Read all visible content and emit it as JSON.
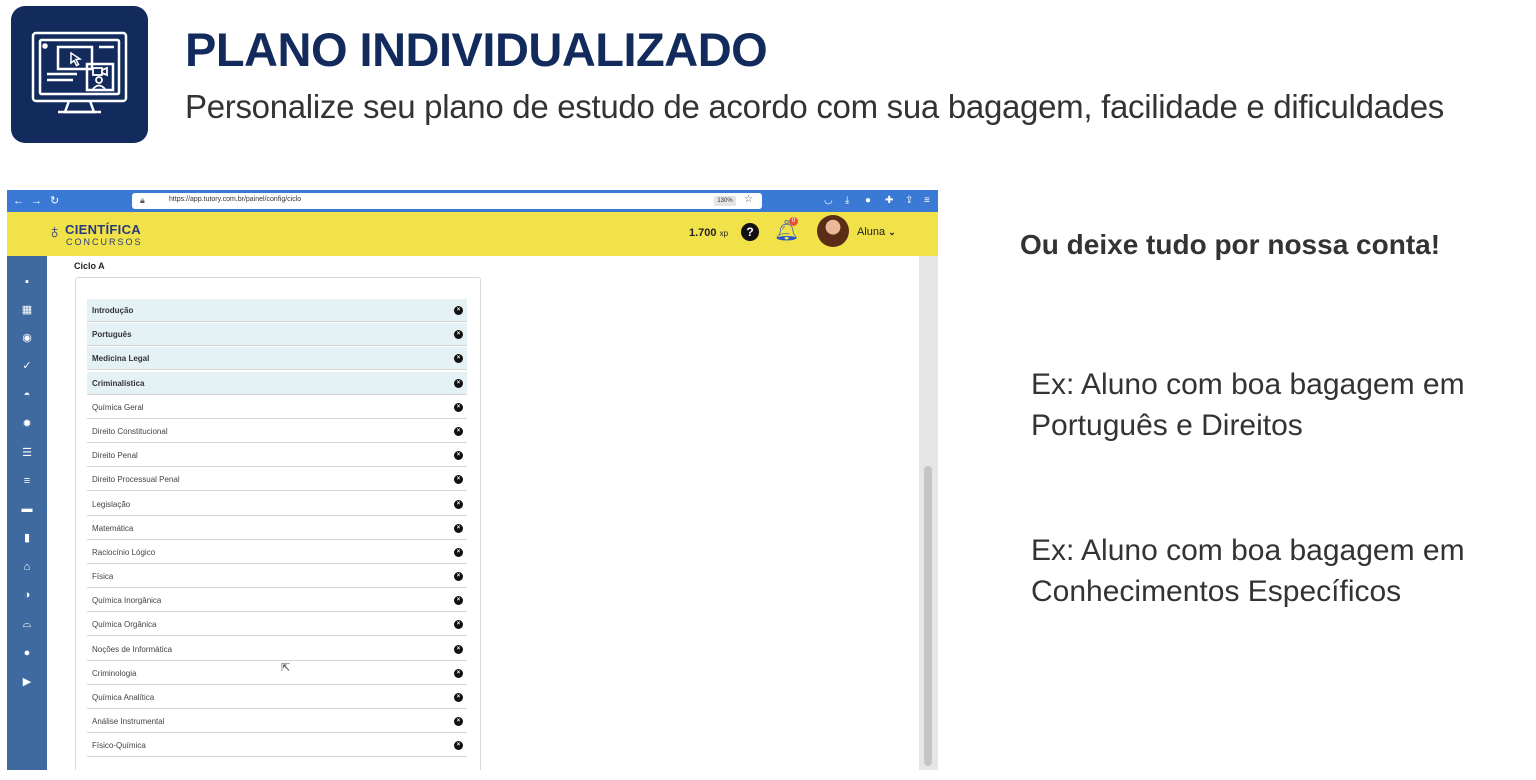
{
  "header": {
    "title": "PLANO INDIVIDUALIZADO",
    "subtitle": "Personalize seu plano de estudo de acordo com sua bagagem, facilidade e dificuldades",
    "icon": "computer-monitor-icon"
  },
  "browser": {
    "url": "https://app.tutory.com.br/painel/config/ciclo",
    "zoom": "130%"
  },
  "app": {
    "logo_name": "CIENTÍFICA",
    "logo_sub": "CONCURSOS",
    "xp_value": "1.700",
    "xp_unit": "xp",
    "notification_count": "0",
    "user_name": "Aluna",
    "cycle_title": "Ciclo A",
    "subjects": [
      {
        "label": "Introdução",
        "active": true
      },
      {
        "label": "Português",
        "active": true
      },
      {
        "label": "Medicina Legal",
        "active": true
      },
      {
        "label": "Criminalística",
        "active": true
      },
      {
        "label": "Química Geral",
        "active": false
      },
      {
        "label": "Direito Constitucional",
        "active": false
      },
      {
        "label": "Direito Penal",
        "active": false
      },
      {
        "label": "Direito Processual Penal",
        "active": false
      },
      {
        "label": "Legislação",
        "active": false
      },
      {
        "label": "Matemática",
        "active": false
      },
      {
        "label": "Raciocínio Lógico",
        "active": false
      },
      {
        "label": "Física",
        "active": false
      },
      {
        "label": "Química Inorgânica",
        "active": false
      },
      {
        "label": "Química Orgânica",
        "active": false
      },
      {
        "label": "Noções de Informática",
        "active": false
      },
      {
        "label": "Criminologia",
        "active": false
      },
      {
        "label": "Química Analítica",
        "active": false
      },
      {
        "label": "Análise Instrumental",
        "active": false
      },
      {
        "label": "Físico-Química",
        "active": false
      }
    ],
    "sidebar_icons": [
      "calendar-icon",
      "calendar-grid-icon",
      "target-icon",
      "check-icon",
      "gauge-icon",
      "gear-icon",
      "list-ordered-icon",
      "align-center-icon",
      "book-icon",
      "document-icon",
      "bank-icon",
      "pie-chart-icon",
      "inbox-icon",
      "chat-icon",
      "play-icon"
    ]
  },
  "right": {
    "heading": "Ou deixe tudo por nossa conta!",
    "example1_line1": "Ex: Aluno com boa bagagem em",
    "example1_line2": "Português e Direitos",
    "example2_line1": "Ex: Aluno com boa bagagem em",
    "example2_line2": "Conhecimentos Específicos"
  },
  "colors": {
    "brand_navy": "#122a5c",
    "app_yellow": "#f2e24a",
    "sidebar_blue": "#3f6aa0",
    "browser_blue": "#3a7ad4",
    "active_row": "#e4f1f5"
  }
}
